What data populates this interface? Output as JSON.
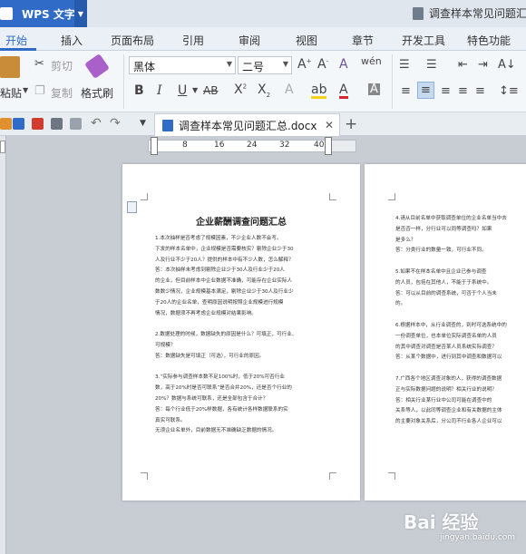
{
  "app": {
    "name": "WPS 文字",
    "window_title": "调查样本常见问题汇"
  },
  "menu": {
    "tabs": [
      "开始",
      "插入",
      "页面布局",
      "引用",
      "审阅",
      "视图",
      "章节",
      "开发工具",
      "特色功能"
    ]
  },
  "ribbon": {
    "paste": "粘贴",
    "cut": "剪切",
    "copy": "复制",
    "format_painter": "格式刷",
    "font_name": "黑体",
    "font_size": "二号"
  },
  "doc_tab": {
    "name": "调查样本常见问题汇总.docx"
  },
  "ruler": {
    "ticks": [
      "8",
      "16",
      "24",
      "32",
      "40"
    ]
  },
  "page1": {
    "title": "企业薪酬调查问题汇总",
    "lines": [
      "1.本次抽样是否考虑了规模因素，不少企业人数不会写。",
      "下发的样本名单中，企业规模是否需要核实？剔除企业少于30",
      "人及行业不少于20人？提供的样本中有不少人数，怎么解释？",
      "答：本次抽样未考虑到剔除企业少于30人及行业少于20人",
      "的企业，但目前样本中企业数据不准确，可能存在企业实际人",
      "数数少情况，企业规模基本满足，剔除企业少于30人及行业少",
      "于20人的企业名单，查明原因说明按照企业规模进行规模",
      "情况，数据须不再考虑企业规模对结果影响。",
      "",
      "2.数据处理的时候，数据缺失的原因是什么？可填正，可行业、",
      "可规模？",
      "答：数据缺失是可填正（可选），可行业的原因。",
      "",
      "3.“实际参与调查样本数不足100%时，低于20%可否行业",
      "数，高于20%时是否可联系”是否合并20%，还是否个行业的",
      "20%？数据与系统可联系，还是全部包含于合计？",
      "答：每个行业低于20%样数据，各有统计各样数据联系的实",
      "真实可联系。",
      "无须企业名单外，目前数据无不准确缺乏数据的情况。"
    ]
  },
  "page2": {
    "lines": [
      "4.请从目前名单中获取调查单位的企业名单当中去",
      "是否否一样，分行业可以同等调查吗？如果",
      "是多么？",
      "答：分类行业的数量一致，可行业不同。",
      "",
      "5.如果不在样本名单中且企业已参与调查",
      "的人员，包括在其他人，不能于于系统中。",
      "答：可以从目前的调查系统，可否于个人当未",
      "的。",
      "",
      "6.根据样本中，从行业调查的，到时可选系统中的",
      "一份调查单位，也本单位实际调查名单的人员",
      "的其中调查对调查是否某人员系统实际调查？",
      "答：从某个数据中，进行到其中调查和数据可以",
      "",
      "7.广西各个地区调查对象的人，获得的调查数据",
      "正与实际数据问题的说明？相关行业的说明？",
      "答：相关行业某行业中公司可能在调查中的",
      "关系等人，以此同等调查企业和有关数据的主体",
      "的主要对象关系后，分公司不行业各人企业可以"
    ]
  },
  "watermark": {
    "main": "Bai 经验",
    "sub": "jingyan.baidu.com"
  }
}
